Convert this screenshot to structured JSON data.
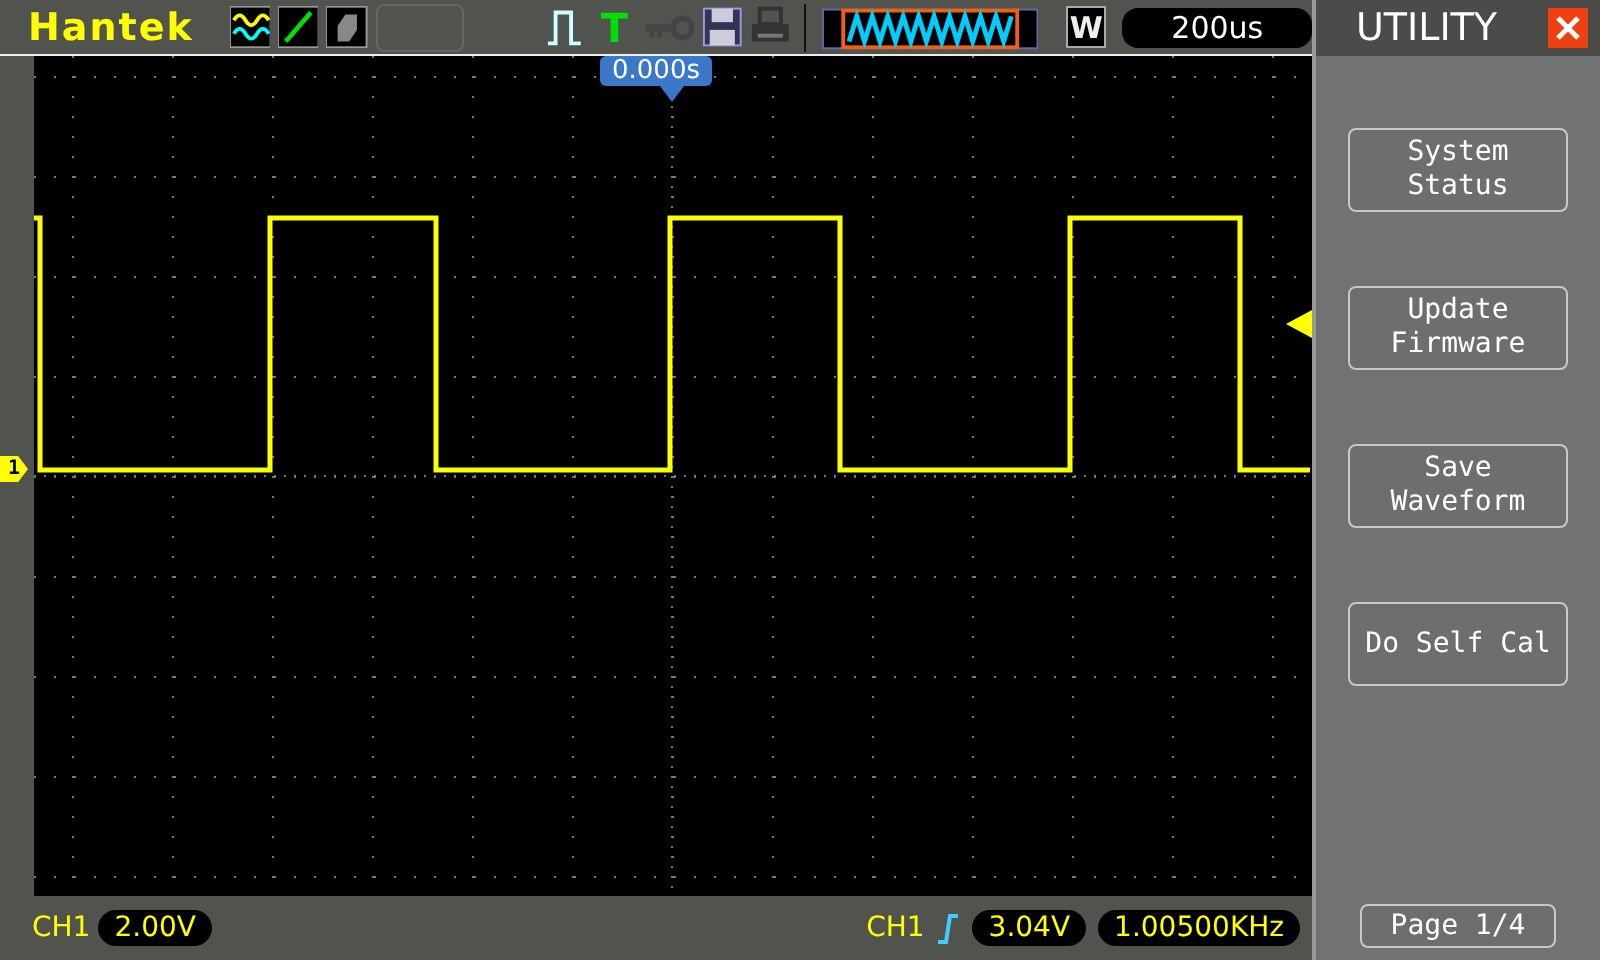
{
  "top_bar": {
    "brand": "Hantek",
    "trigger_type": "T",
    "acquire_mode": "W",
    "timebase": "200us"
  },
  "panel": {
    "title": "UTILITY",
    "buttons": [
      {
        "label": "System Status"
      },
      {
        "label": "Update Firmware"
      },
      {
        "label": "Save Waveform"
      },
      {
        "label": "Do Self Cal"
      }
    ],
    "page": "Page 1/4"
  },
  "screen": {
    "trigger_position": "0.000s",
    "channel_marker": "1"
  },
  "status_bar": {
    "channel": "CH1",
    "scale": "2.00V",
    "trigger_source": "CH1",
    "trigger_level": "3.04V",
    "frequency": "1.00500KHz"
  }
}
